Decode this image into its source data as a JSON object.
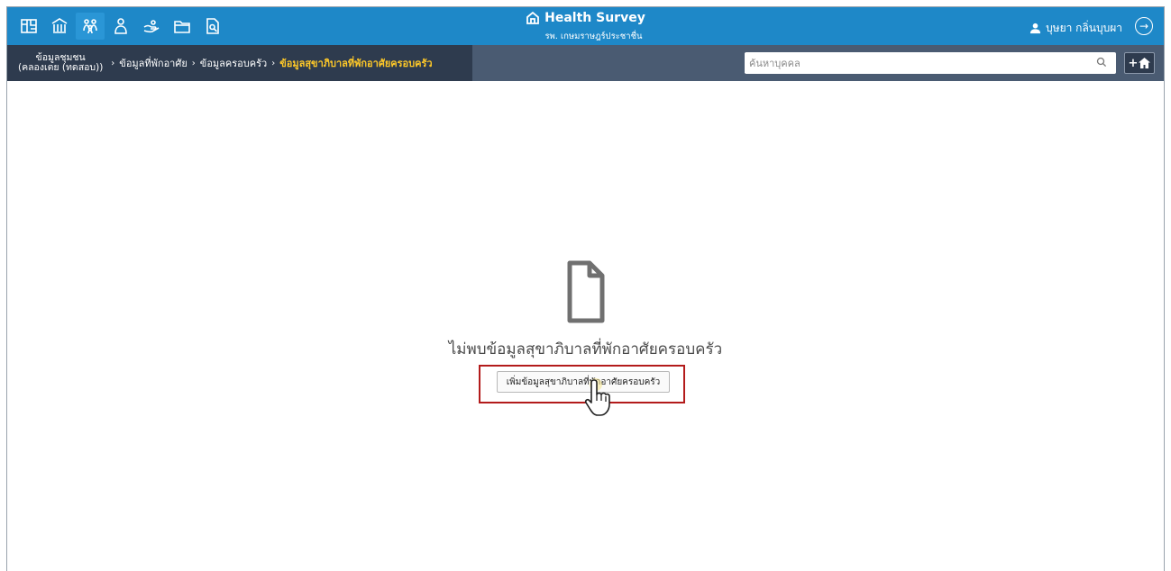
{
  "app": {
    "title": "Health Survey",
    "subtitle": "รพ. เกษมราษฎร์ประชาชื่น",
    "user_name": "บุษยา กลิ่นบุบผา"
  },
  "nav": {
    "icons": [
      "map-icon",
      "building-icon",
      "family-icon",
      "person-icon",
      "hand-icon",
      "folder-icon",
      "report-search-icon"
    ],
    "active_index": 2
  },
  "breadcrumb": {
    "items": [
      {
        "label_line1": "ข้อมูลชุมชน",
        "label_line2": "(คลองเตย (ทดสอบ))"
      },
      {
        "label": "ข้อมูลที่พักอาศัย"
      },
      {
        "label": "ข้อมูลครอบครัว"
      },
      {
        "label": "ข้อมูลสุขาภิบาลที่พักอาศัยครอบครัว"
      }
    ],
    "separator": "›"
  },
  "search": {
    "placeholder": "ค้นหาบุคคล",
    "value": ""
  },
  "toolbar": {
    "add_home_label": "+"
  },
  "empty_state": {
    "message": "ไม่พบข้อมูลสุขาภิบาลที่พักอาศัยครอบครัว",
    "button_label": "เพิ่มข้อมูลสุขาภิบาลที่พักอาศัยครอบครัว"
  },
  "colors": {
    "topbar": "#1e88c8",
    "subbar": "#4a5b72",
    "breadcrumb_bg": "#2e3b4e",
    "breadcrumb_current": "#ffc928",
    "highlight": "#b31b1b"
  }
}
